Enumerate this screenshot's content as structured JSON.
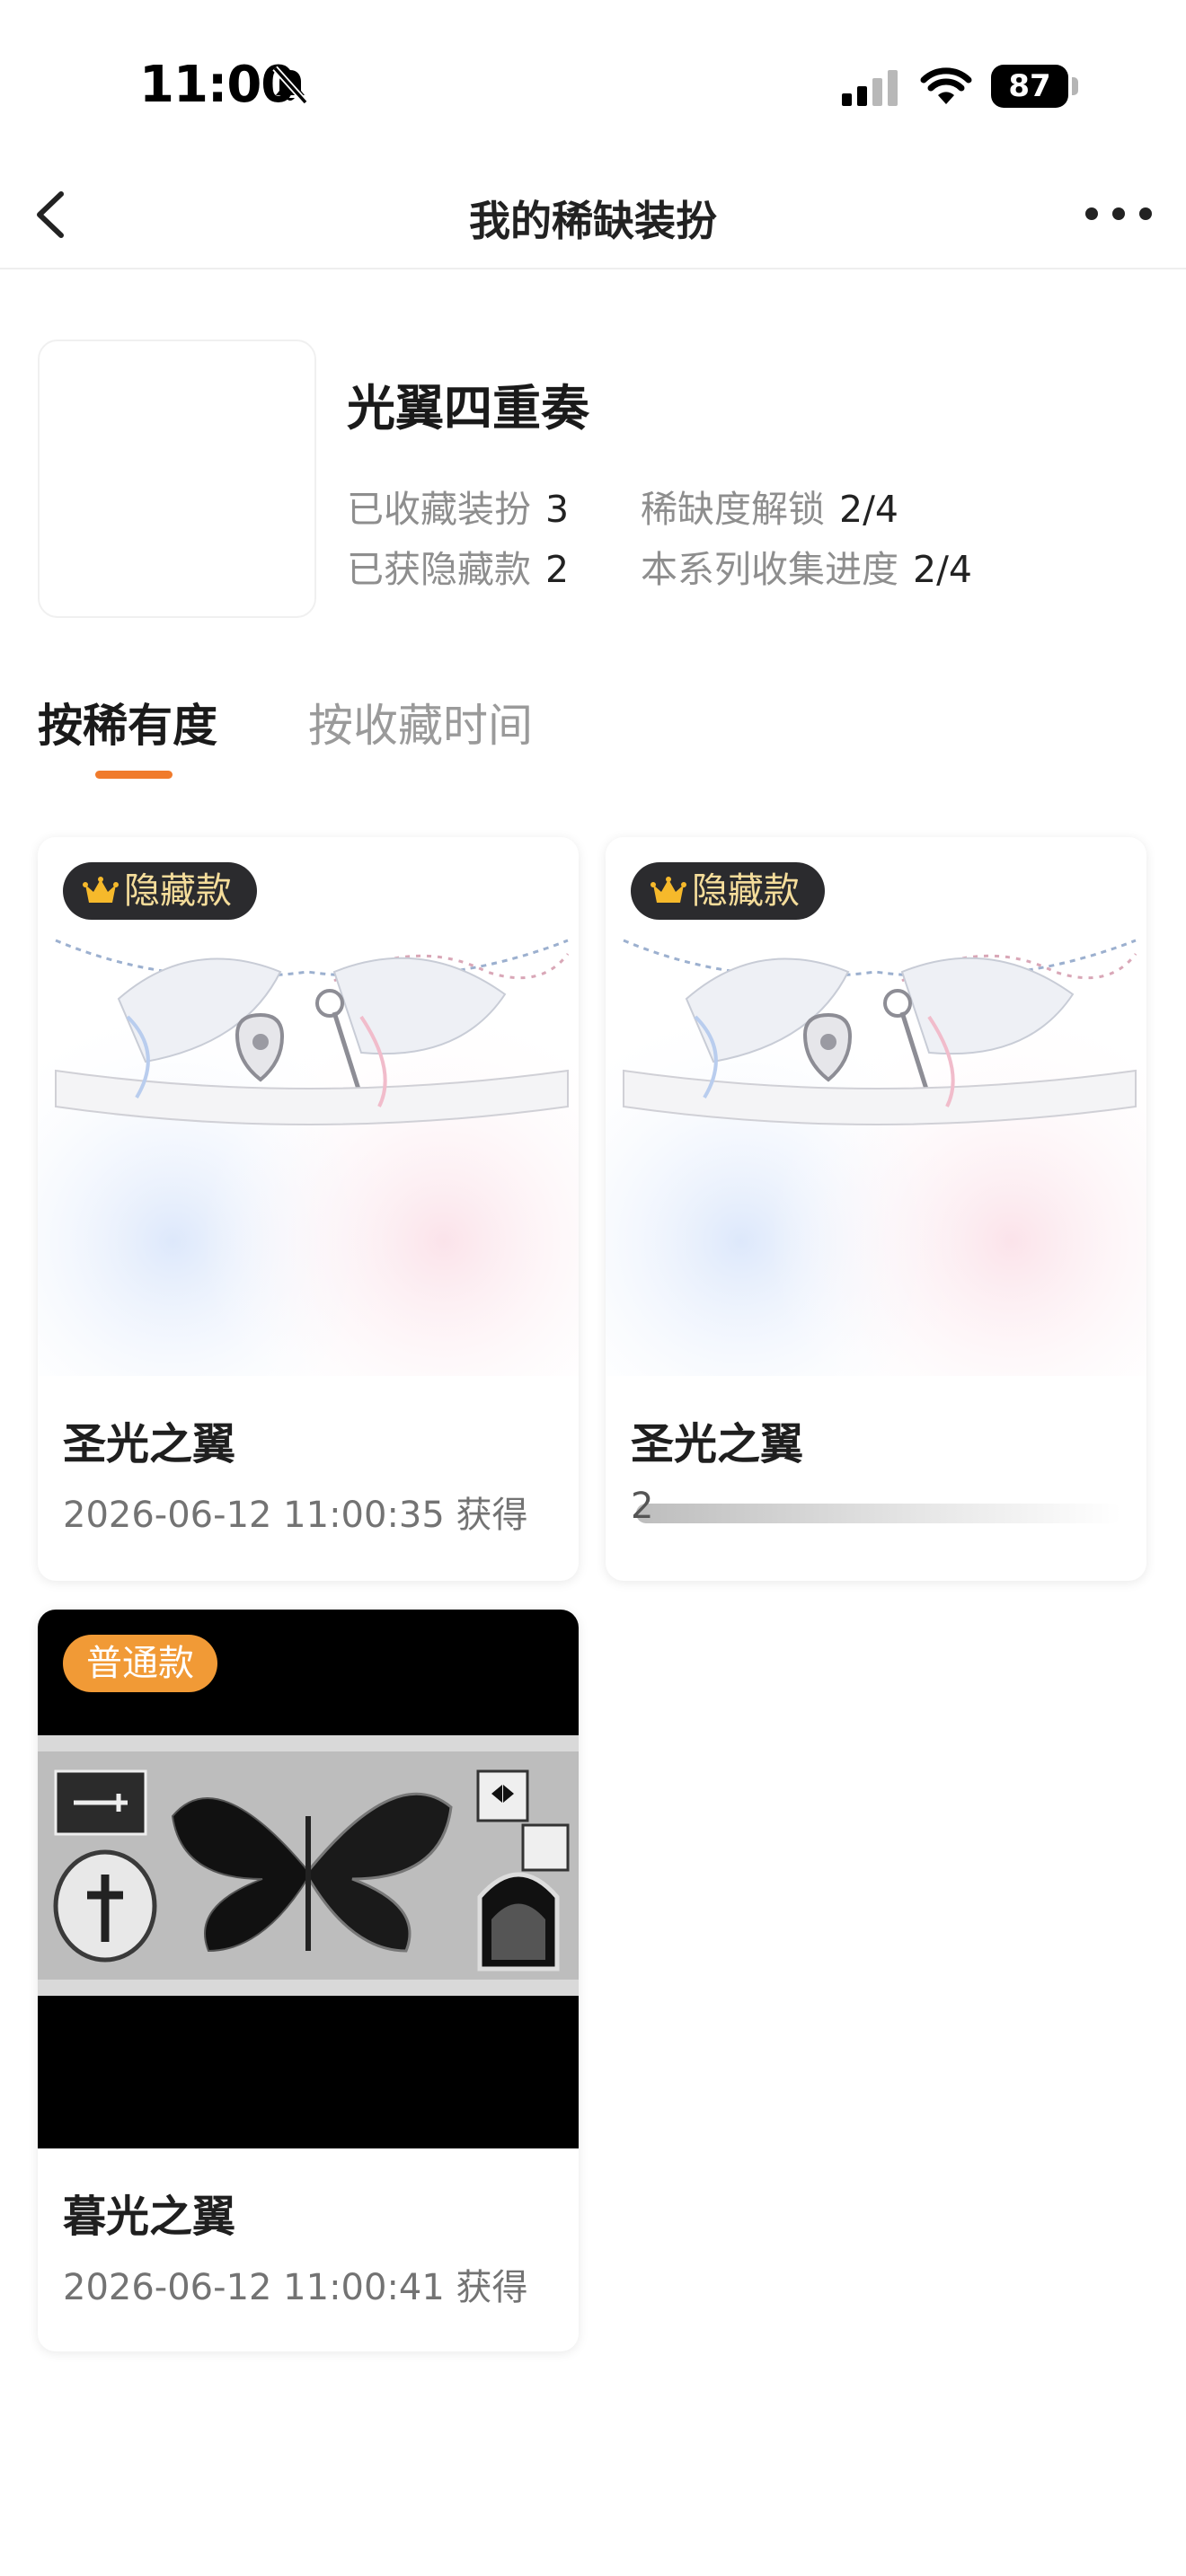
{
  "status_bar": {
    "time": "11:00",
    "battery": "87"
  },
  "nav": {
    "title": "我的稀缺装扮"
  },
  "series": {
    "name": "光翼四重奏",
    "stats": [
      {
        "label": "已收藏装扮",
        "value": "3"
      },
      {
        "label": "稀缺度解锁",
        "value": "2/4"
      },
      {
        "label": "已获隐藏款",
        "value": "2"
      },
      {
        "label": "本系列收集进度",
        "value": "2/4"
      }
    ]
  },
  "tabs": [
    {
      "label": "按稀有度",
      "active": true
    },
    {
      "label": "按收藏时间",
      "active": false
    }
  ],
  "cards": [
    {
      "badge": "隐藏款",
      "title": "圣光之翼",
      "date": "2026-06-12 11:00:35 获得"
    },
    {
      "badge": "隐藏款",
      "title": "圣光之翼",
      "date": "2",
      "loading": true
    },
    {
      "badge": "普通款",
      "title": "暮光之翼",
      "date": "2026-06-12 11:00:41 获得"
    }
  ],
  "colors": {
    "accent": "#f07b2c",
    "normal_badge": "#f19a36",
    "hidden_badge_bg": "#2b2b2e",
    "hidden_badge_text": "#f4dc9a"
  },
  "icons": [
    "bell-slash-icon",
    "cellular-signal-icon",
    "wifi-icon",
    "battery-icon",
    "back-icon",
    "more-icon",
    "crown-icon"
  ]
}
